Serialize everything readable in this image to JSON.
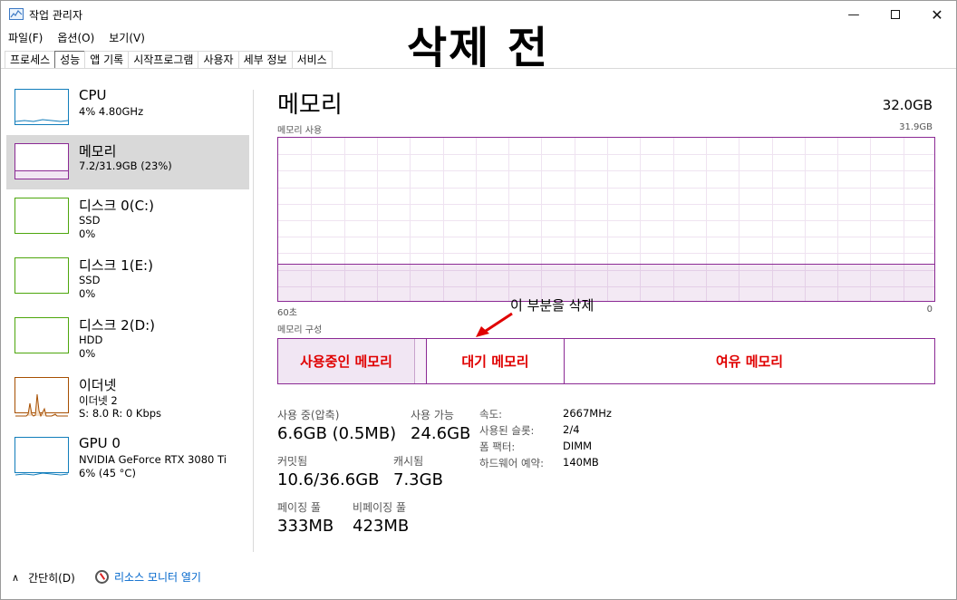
{
  "window": {
    "title": "작업 관리자"
  },
  "overlay": {
    "title": "삭제 전",
    "annotation": "이 부분을 삭제"
  },
  "menu": [
    {
      "label": "파일(F)"
    },
    {
      "label": "옵션(O)"
    },
    {
      "label": "보기(V)"
    }
  ],
  "tabs": [
    {
      "label": "프로세스"
    },
    {
      "label": "성능"
    },
    {
      "label": "앱 기록"
    },
    {
      "label": "시작프로그램"
    },
    {
      "label": "사용자"
    },
    {
      "label": "세부 정보"
    },
    {
      "label": "서비스"
    }
  ],
  "sidebar": {
    "items": [
      {
        "name": "CPU",
        "lines": [
          "4% 4.80GHz"
        ]
      },
      {
        "name": "메모리",
        "lines": [
          "7.2/31.9GB (23%)"
        ]
      },
      {
        "name": "디스크 0(C:)",
        "lines": [
          "SSD",
          "0%"
        ]
      },
      {
        "name": "디스크 1(E:)",
        "lines": [
          "SSD",
          "0%"
        ]
      },
      {
        "name": "디스크 2(D:)",
        "lines": [
          "HDD",
          "0%"
        ]
      },
      {
        "name": "이더넷",
        "lines": [
          "이더넷 2",
          "S: 8.0  R: 0 Kbps"
        ]
      },
      {
        "name": "GPU 0",
        "lines": [
          "NVIDIA GeForce RTX 3080 Ti",
          "6% (45 °C)"
        ]
      }
    ]
  },
  "memory": {
    "title": "메모리",
    "total": "32.0GB",
    "usage_label": "메모리 사용",
    "usage_max": "31.9GB",
    "time_left": "60초",
    "time_right": "0",
    "usage_fraction": 0.23,
    "composition_label": "메모리 구성",
    "composition": {
      "in_use": "사용중인 메모리",
      "standby": "대기 메모리",
      "free": "여유 메모리"
    },
    "stats": {
      "in_use_label": "사용 중(압축)",
      "in_use_value": "6.6GB (0.5MB)",
      "available_label": "사용 가능",
      "available_value": "24.6GB",
      "committed_label": "커밋됨",
      "committed_value": "10.6/36.6GB",
      "cached_label": "캐시됨",
      "cached_value": "7.3GB",
      "paged_label": "페이징 풀",
      "paged_value": "333MB",
      "nonpaged_label": "비페이징 풀",
      "nonpaged_value": "423MB"
    },
    "details": [
      {
        "label": "속도:",
        "value": "2667MHz"
      },
      {
        "label": "사용된 슬롯:",
        "value": "2/4"
      },
      {
        "label": "폼 팩터:",
        "value": "DIMM"
      },
      {
        "label": "하드웨어 예약:",
        "value": "140MB"
      }
    ]
  },
  "footer": {
    "fewer_details": "간단히(D)",
    "resource_monitor": "리소스 모니터 열기"
  },
  "colors": {
    "memory": "#8b2a94",
    "cpu": "#117dbb",
    "disk": "#4da60c",
    "ethernet": "#a74f01",
    "gpu": "#117dbb",
    "annotation": "#e00000"
  }
}
